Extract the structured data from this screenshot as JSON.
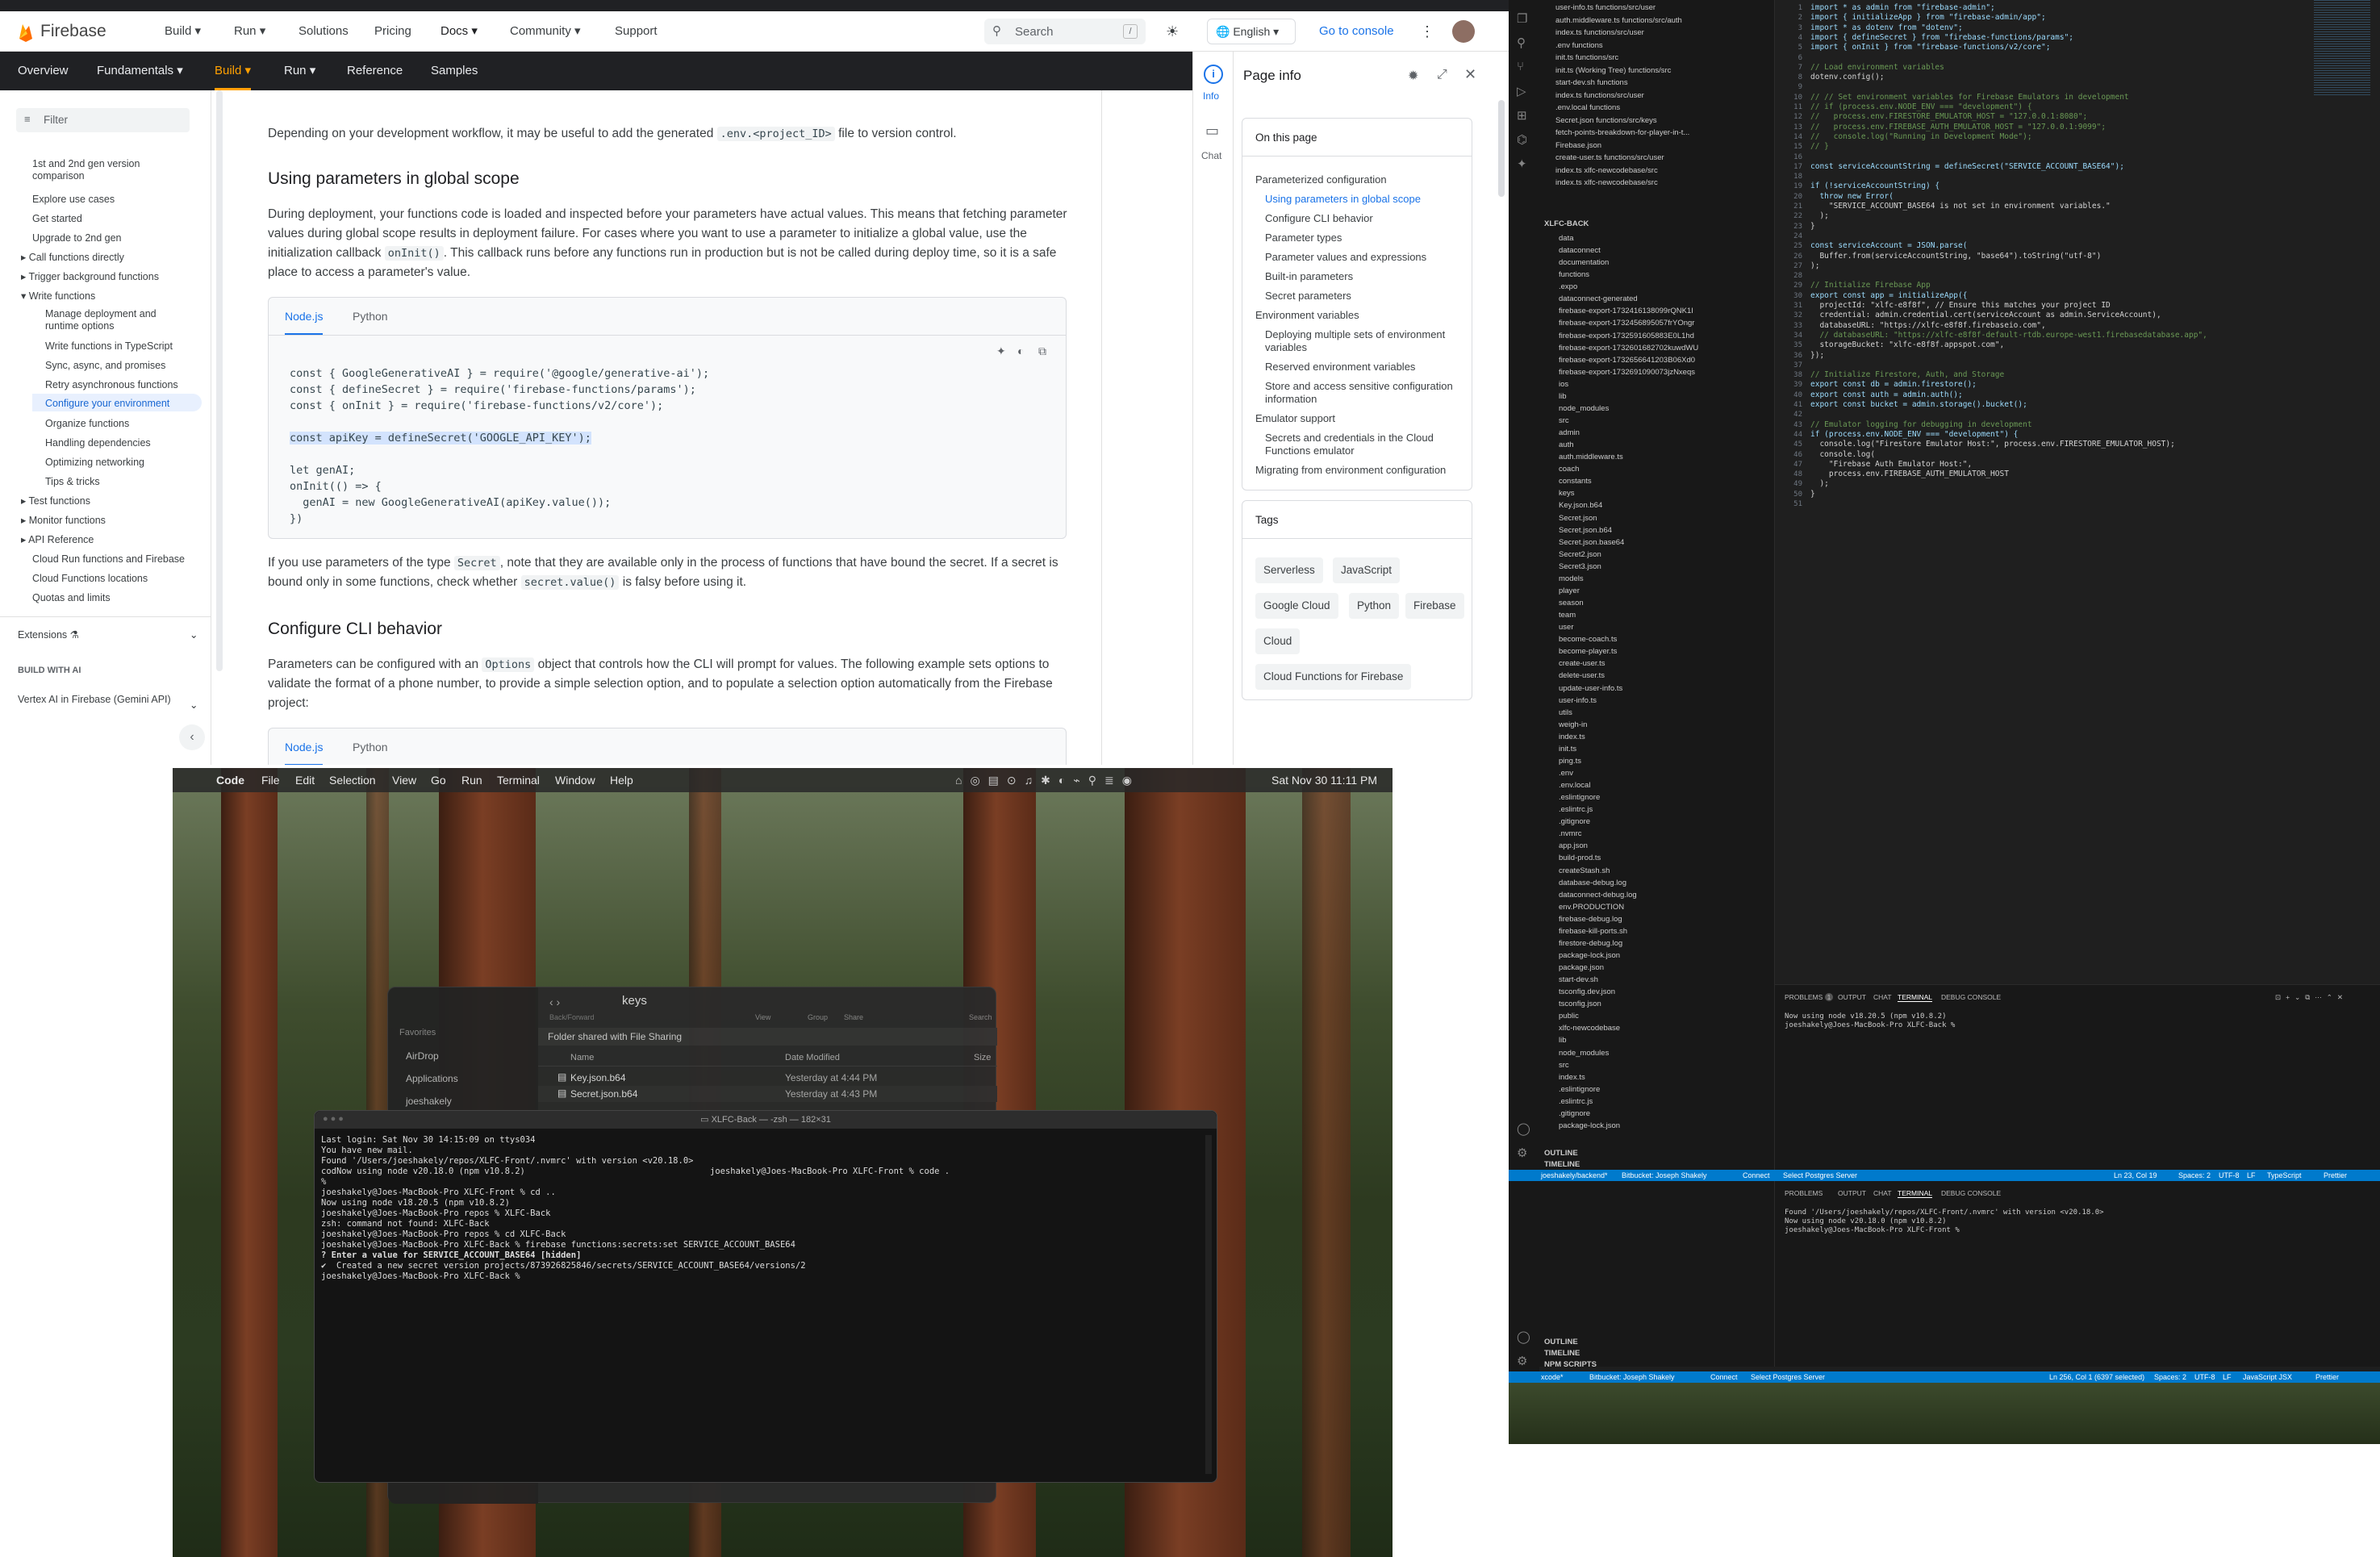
{
  "browser": {
    "brand": "Firebase",
    "nav": [
      "Build",
      "Run",
      "Solutions",
      "Pricing",
      "Docs",
      "Community",
      "Support"
    ],
    "search_placeholder": "Search",
    "search_shortcut": "/",
    "language": "English",
    "console_link": "Go to console",
    "subnav": [
      "Overview",
      "Fundamentals",
      "Build",
      "Run",
      "Reference",
      "Samples"
    ],
    "filter_placeholder": "Filter",
    "sidebar": [
      "1st and 2nd gen version comparison",
      "Explore use cases",
      "Get started",
      "Upgrade to 2nd gen",
      "Call functions directly",
      "Trigger background functions",
      "Write functions",
      "Manage deployment and runtime options",
      "Write functions in TypeScript",
      "Sync, async, and promises",
      "Retry asynchronous functions",
      "Configure your environment",
      "Organize functions",
      "Handling dependencies",
      "Optimizing networking",
      "Tips & tricks",
      "Test functions",
      "Monitor functions",
      "API Reference",
      "Cloud Run functions and Firebase",
      "Cloud Functions locations",
      "Quotas and limits"
    ],
    "sidebar_extensions": "Extensions",
    "sidebar_build_ai": "BUILD WITH AI",
    "sidebar_vertex": "Vertex AI in Firebase (Gemini API)",
    "article": {
      "p0a": "Depending on your development workflow, it may be useful to add the generated",
      "p0code": ".env.<project_ID>",
      "p0b": "file to version control.",
      "h_global": "Using parameters in global scope",
      "p1a": "During deployment, your functions code is loaded and inspected before your parameters have actual values. This means that fetching parameter values during global scope results in deployment failure. For cases where you want to use a parameter to initialize a global value, use the initialization callback",
      "p1code": "onInit()",
      "p1b": ". This callback runs before any functions run in production but is not be called during deploy time, so it is a safe place to access a parameter's value.",
      "tab_node": "Node.js",
      "tab_python": "Python",
      "code": [
        "const { GoogleGenerativeAI } = require('@google/generative-ai');",
        "const { defineSecret } = require('firebase-functions/params');",
        "const { onInit } = require('firebase-functions/v2/core');",
        "",
        "const apiKey = defineSecret('GOOGLE_API_KEY');",
        "",
        "let genAI;",
        "onInit(() => {",
        "  genAI = new GoogleGenerativeAI(apiKey.value());",
        "})"
      ],
      "p2a": "If you use parameters of the type",
      "p2code": "Secret",
      "p2b": ", note that they are available only in the process of functions that have bound the secret. If a secret is bound only in some functions, check whether",
      "p2code2": "secret.value()",
      "p2c": "is falsy before using it.",
      "h_cli": "Configure CLI behavior",
      "p3a": "Parameters can be configured with an",
      "p3code": "Options",
      "p3b": "object that controls how the CLI will prompt for values. The following example sets options to validate the format of a phone number, to provide a simple selection option, and to populate a selection option automatically from the Firebase project:"
    },
    "panel": {
      "rail_info": "Info",
      "rail_chat": "Chat",
      "title": "Page info",
      "toc_heading": "On this page",
      "toc": [
        "Parameterized configuration",
        "Using parameters in global scope",
        "Configure CLI behavior",
        "Parameter types",
        "Parameter values and expressions",
        "Built-in parameters",
        "Secret parameters",
        "Environment variables",
        "Deploying multiple sets of environment variables",
        "Reserved environment variables",
        "Store and access sensitive configuration information",
        "Emulator support",
        "Secrets and credentials in the Cloud Functions emulator",
        "Migrating from environment configuration"
      ],
      "tags_heading": "Tags",
      "tags": [
        "Serverless",
        "JavaScript",
        "Google Cloud",
        "Python",
        "Firebase",
        "Cloud",
        "Cloud Functions for Firebase"
      ]
    }
  },
  "desktop": {
    "menubar": [
      "Code",
      "File",
      "Edit",
      "Selection",
      "View",
      "Go",
      "Run",
      "Terminal",
      "Window",
      "Help"
    ],
    "clock": "Sat Nov 30  11:11 PM",
    "finder": {
      "folder": "keys",
      "nav_label": "Back/Forward",
      "toolbar": [
        "View",
        "Group",
        "Share",
        "Search"
      ],
      "sidebar_heading": "Favorites",
      "sidebar": [
        "AirDrop",
        "Applications",
        "joeshakely"
      ],
      "banner": "Folder shared with File Sharing",
      "cols": [
        "Name",
        "Date Modified",
        "Size"
      ],
      "files": [
        {
          "name": "Key.json.b64",
          "date": "Yesterday at 4:44 PM"
        },
        {
          "name": "Secret.json.b64",
          "date": "Yesterday at 4:43 PM"
        }
      ]
    },
    "terminal": {
      "title": "XLFC-Back — -zsh — 182×31",
      "lines": [
        "Last login: Sat Nov 30 14:15:09 on ttys034",
        "You have new mail.",
        "Found '/Users/joeshakely/repos/XLFC-Front/.nvmrc' with version <v20.18.0>",
        "codNow using node v20.18.0 (npm v10.8.2)",
        "%",
        "joeshakely@Joes-MacBook-Pro XLFC-Front % cd ..",
        "Now using node v18.20.5 (npm v10.8.2)",
        "joeshakely@Joes-MacBook-Pro repos % XLFC-Back",
        "zsh: command not found: XLFC-Back",
        "joeshakely@Joes-MacBook-Pro repos % cd XLFC-Back",
        "joeshakely@Joes-MacBook-Pro XLFC-Back % firebase functions:secrets:set SERVICE_ACCOUNT_BASE64",
        "? Enter a value for SERVICE_ACCOUNT_BASE64 [hidden]",
        "✔  Created a new secret version projects/873926825846/secrets/SERVICE_ACCOUNT_BASE64/versions/2",
        "joeshakely@Joes-MacBook-Pro XLFC-Back % "
      ],
      "side_line": "joeshakely@Joes-MacBook-Pro XLFC-Front % code ."
    }
  },
  "vscode": {
    "explorer_top": [
      "user-info.ts functions/src/user",
      "auth.middleware.ts functions/src/auth",
      "index.ts functions/src/user",
      ".env functions",
      "init.ts functions/src",
      "init.ts (Working Tree) functions/src",
      "start-dev.sh functions",
      "index.ts functions/src/user",
      ".env.local functions",
      "Secret.json functions/src/keys",
      "fetch-points-breakdown-for-player-in-t...",
      "Firebase.json",
      "create-user.ts functions/src/user",
      "index.ts xlfc-newcodebase/src",
      "index.ts xlfc-newcodebase/src"
    ],
    "root": "XLFC-BACK",
    "tree": [
      "data",
      "dataconnect",
      "documentation",
      "functions",
      ".expo",
      "dataconnect-generated",
      "firebase-export-1732416138099rQNK1I",
      "firebase-export-1732456895057frYOngr",
      "firebase-export-1732591605883E0L1hd",
      "firebase-export-1732601682702kuwdWU",
      "firebase-export-1732656641203B06Xd0",
      "firebase-export-1732691090073jzNxeqs",
      "ios",
      "lib",
      "node_modules",
      "src",
      "admin",
      "auth",
      "auth.middleware.ts",
      "coach",
      "constants",
      "keys",
      "Key.json.b64",
      "Secret.json",
      "Secret.json.b64",
      "Secret.json.base64",
      "Secret2.json",
      "Secret3.json",
      "models",
      "player",
      "season",
      "team",
      "user",
      "become-coach.ts",
      "become-player.ts",
      "create-user.ts",
      "delete-user.ts",
      "update-user-info.ts",
      "user-info.ts",
      "utils",
      "weigh-in",
      "index.ts",
      "init.ts",
      "ping.ts",
      ".env",
      ".env.local",
      ".eslintignore",
      ".eslintrc.js",
      ".gitignore",
      ".nvmrc",
      "app.json",
      "build-prod.ts",
      "createStash.sh",
      "database-debug.log",
      "dataconnect-debug.log",
      "env.PRODUCTION",
      "firebase-debug.log",
      "firebase-kill-ports.sh",
      "firestore-debug.log",
      "package-lock.json",
      "package.json",
      "start-dev.sh",
      "tsconfig.dev.json",
      "tsconfig.json",
      "public",
      "xlfc-newcodebase",
      "lib",
      "node_modules",
      "src",
      "index.ts",
      ".eslintignore",
      ".eslintrc.js",
      ".gitignore",
      "package-lock.json"
    ],
    "outline": "OUTLINE",
    "timeline": "TIMELINE",
    "npm_scripts": "NPM SCRIPTS",
    "code": [
      "import * as admin from \"firebase-admin\";",
      "import { initializeApp } from \"firebase-admin/app\";",
      "import * as dotenv from \"dotenv\";",
      "import { defineSecret } from \"firebase-functions/params\";",
      "import { onInit } from \"firebase-functions/v2/core\";",
      "",
      "// Load environment variables",
      "dotenv.config();",
      "",
      "// // Set environment variables for Firebase Emulators in development",
      "// if (process.env.NODE_ENV === \"development\") {",
      "//   process.env.FIRESTORE_EMULATOR_HOST = \"127.0.0.1:8080\";",
      "//   process.env.FIREBASE_AUTH_EMULATOR_HOST = \"127.0.0.1:9099\";",
      "//   console.log(\"Running in Development Mode\");",
      "// }",
      "",
      "const serviceAccountString = defineSecret(\"SERVICE_ACCOUNT_BASE64\");",
      "",
      "if (!serviceAccountString) {",
      "  throw new Error(",
      "    \"SERVICE_ACCOUNT_BASE64 is not set in environment variables.\"",
      "  );",
      "}",
      "",
      "const serviceAccount = JSON.parse(",
      "  Buffer.from(serviceAccountString, \"base64\").toString(\"utf-8\")",
      ");",
      "",
      "// Initialize Firebase App",
      "export const app = initializeApp({",
      "  projectId: \"xlfc-e8f8f\", // Ensure this matches your project ID",
      "  credential: admin.credential.cert(serviceAccount as admin.ServiceAccount),",
      "  databaseURL: \"https://xlfc-e8f8f.firebaseio.com\",",
      "  // databaseURL: \"https://xlfc-e8f8f-default-rtdb.europe-west1.firebasedatabase.app\",",
      "  storageBucket: \"xlfc-e8f8f.appspot.com\",",
      "});",
      "",
      "// Initialize Firestore, Auth, and Storage",
      "export const db = admin.firestore();",
      "export const auth = admin.auth();",
      "export const bucket = admin.storage().bucket();",
      "",
      "// Emulator logging for debugging in development",
      "if (process.env.NODE_ENV === \"development\") {",
      "  console.log(\"Firestore Emulator Host:\", process.env.FIRESTORE_EMULATOR_HOST);",
      "  console.log(",
      "    \"Firebase Auth Emulator Host:\",",
      "    process.env.FIREBASE_AUTH_EMULATOR_HOST",
      "  );",
      "}",
      ""
    ],
    "panel_tabs": [
      "PROBLEMS",
      "OUTPUT",
      "CHAT",
      "TERMINAL",
      "DEBUG CONSOLE"
    ],
    "problems_count": "1",
    "terminal1": [
      "Now using node v18.20.5 (npm v10.8.2)",
      "joeshakely@Joes-MacBook-Pro XLFC-Back %"
    ],
    "status1": [
      "joeshakely/backend*",
      "Bitbucket: Joseph Shakely",
      "Connect",
      "Select Postgres Server",
      "Ln 23, Col 19",
      "Spaces: 2",
      "UTF-8",
      "LF",
      "TypeScript",
      "Prettier"
    ],
    "terminal2": [
      "Found '/Users/joeshakely/repos/XLFC-Front/.nvmrc' with version <v20.18.0>",
      "Now using node v20.18.0 (npm v10.8.2)",
      "joeshakely@Joes-MacBook-Pro XLFC-Front %"
    ],
    "status2": [
      "xcode*",
      "Bitbucket: Joseph Shakely",
      "Connect",
      "Select Postgres Server",
      "Ln 256, Col 1 (6397 selected)",
      "Spaces: 2",
      "UTF-8",
      "LF",
      "JavaScript JSX",
      "Prettier"
    ]
  },
  "colors": {
    "firebase_orange": "#ff8a00",
    "link_blue": "#1a73e8",
    "vscode_blue": "#007acc"
  }
}
